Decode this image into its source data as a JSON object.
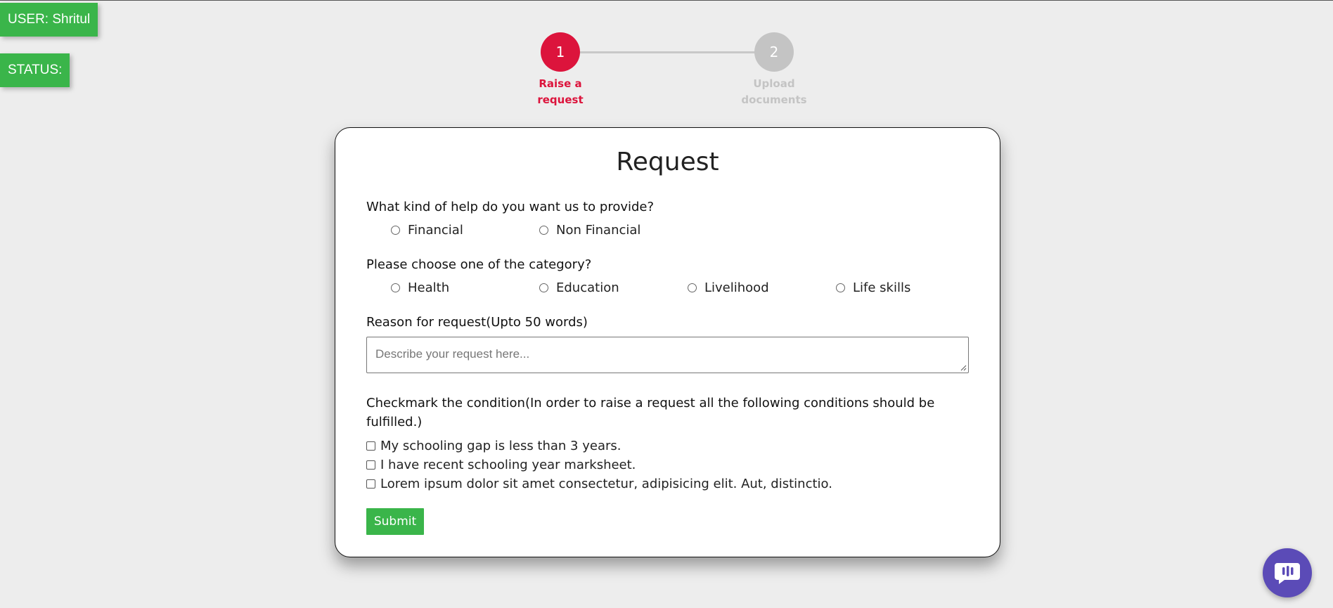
{
  "header": {
    "user_badge": "USER: Shritul",
    "status_badge": "STATUS:"
  },
  "stepper": {
    "steps": [
      {
        "number": "1",
        "label_line1": "Raise a",
        "label_line2": "request",
        "state": "active"
      },
      {
        "number": "2",
        "label_line1": "Upload",
        "label_line2": "documents",
        "state": "inactive"
      }
    ]
  },
  "form": {
    "title": "Request",
    "help_question": "What kind of help do you want us to provide?",
    "help_options": [
      "Financial",
      "Non Financial"
    ],
    "category_question": "Please choose one of the category?",
    "category_options": [
      "Health",
      "Education",
      "Livelihood",
      "Life skills"
    ],
    "reason_label": "Reason for request(Upto 50 words)",
    "reason_placeholder": "Describe your request here...",
    "conditions_title": "Checkmark the condition(In order to raise a request all the following conditions should be fulfilled.)",
    "conditions": [
      "My schooling gap is less than 3 years.",
      "I have recent schooling year marksheet.",
      "Lorem ipsum dolor sit amet consectetur, adipisicing elit. Aut, distinctio."
    ],
    "submit_label": "Submit"
  },
  "colors": {
    "accent_green": "#3ab54a",
    "active_step": "#dc143c",
    "inactive_step": "#c4c4c4",
    "chat_button": "#5b4bb7"
  },
  "icons": {
    "chat": "chat-bubble-icon"
  }
}
